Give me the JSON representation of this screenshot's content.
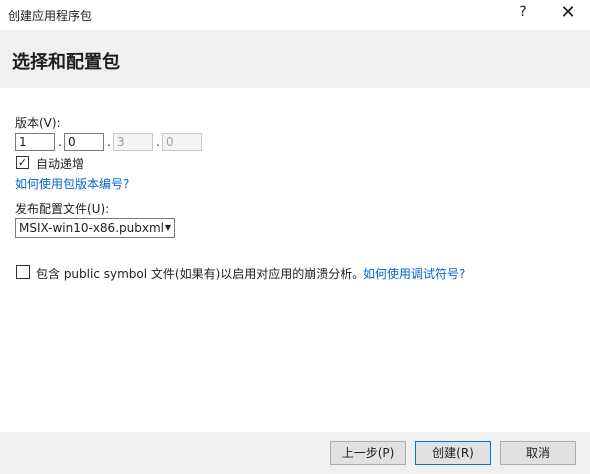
{
  "window": {
    "title": "创建应用程序包",
    "help_icon": "?",
    "close_icon": "✕"
  },
  "page": {
    "title": "选择和配置包"
  },
  "version": {
    "label": "版本(V):",
    "parts": [
      "1",
      "0",
      "3",
      "0"
    ],
    "auto_increment_label": "自动递增",
    "auto_increment_checked": true,
    "help_link": "如何使用包版本编号?"
  },
  "publish": {
    "label": "发布配置文件(U):",
    "selected": "MSIX-win10-x86.pubxml"
  },
  "symbols": {
    "label": "包含 public symbol 文件(如果有)以启用对应用的崩溃分析。",
    "checked": false,
    "help_link": "如何使用调试符号?"
  },
  "buttons": {
    "prev": "上一步(P)",
    "create": "创建(R)",
    "cancel": "取消"
  }
}
